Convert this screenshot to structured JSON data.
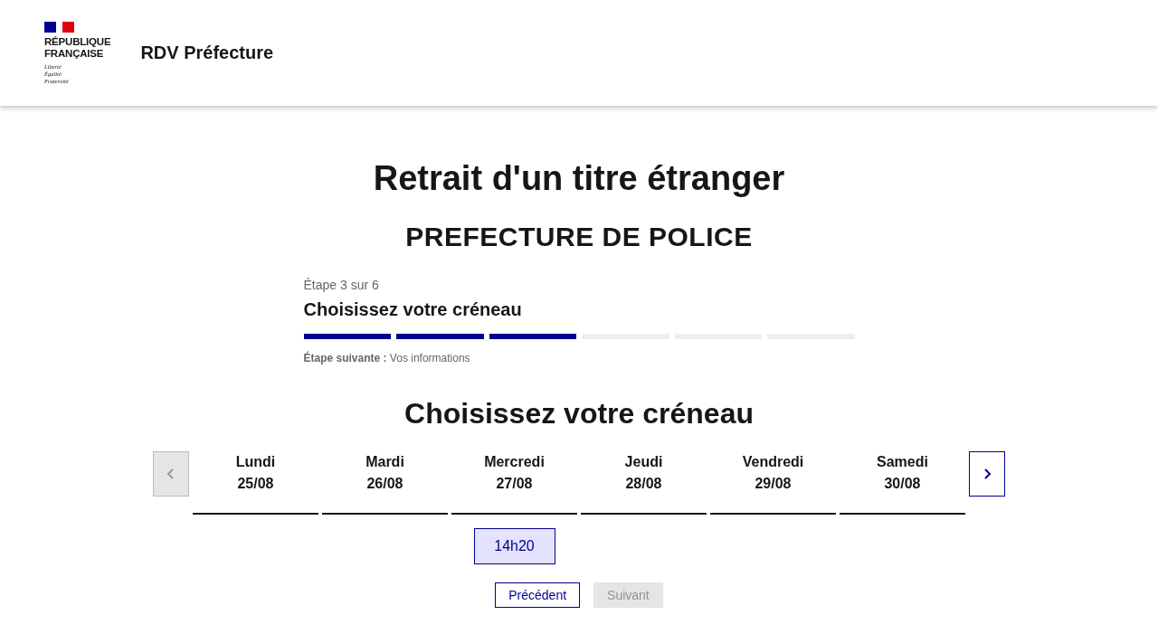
{
  "header": {
    "logo_lines": [
      "RÉPUBLIQUE",
      "FRANÇAISE"
    ],
    "motto": [
      "Liberté",
      "Égalité",
      "Fraternité"
    ],
    "service_name": "RDV Préfecture"
  },
  "title": "Retrait d'un titre étranger",
  "subtitle": "PREFECTURE DE POLICE",
  "stepper": {
    "counter": "Étape 3 sur 6",
    "current": "Choisissez votre créneau",
    "steps": [
      {
        "done": true
      },
      {
        "done": true
      },
      {
        "done": true
      },
      {
        "done": false
      },
      {
        "done": false
      },
      {
        "done": false
      }
    ],
    "next_label": "Étape suivante :",
    "next_value": "Vos informations"
  },
  "section_title": "Choisissez votre créneau",
  "calendar": {
    "prev_disabled": true,
    "next_disabled": false,
    "days": [
      {
        "name": "Lundi",
        "date": "25/08"
      },
      {
        "name": "Mardi",
        "date": "26/08"
      },
      {
        "name": "Mercredi",
        "date": "27/08",
        "slots": [
          {
            "time": "14h20",
            "selected": true
          }
        ]
      },
      {
        "name": "Jeudi",
        "date": "28/08"
      },
      {
        "name": "Vendredi",
        "date": "29/08"
      },
      {
        "name": "Samedi",
        "date": "30/08"
      }
    ]
  },
  "buttons": [
    {
      "label": "Précédent",
      "disabled": false
    },
    {
      "label": "Suivant",
      "disabled": true
    }
  ]
}
